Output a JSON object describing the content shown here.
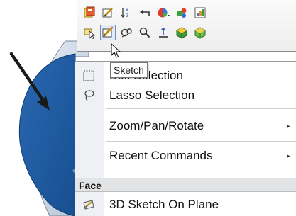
{
  "toolbar": {
    "row1": [
      {
        "icon": "component-properties-icon"
      },
      {
        "icon": "edit-sketch-icon"
      },
      {
        "icon": "sort-icon"
      },
      {
        "icon": "undo-arrow-icon"
      },
      {
        "icon": "appearance-icon"
      },
      {
        "icon": "add-relation-icon"
      },
      {
        "icon": "chart-icon"
      }
    ],
    "row2": [
      {
        "icon": "select-icon"
      },
      {
        "icon": "sketch-icon"
      },
      {
        "icon": "view-orientation-icon"
      },
      {
        "icon": "zoom-icon"
      },
      {
        "icon": "normal-to-icon"
      },
      {
        "icon": "box-shape-icon"
      },
      {
        "icon": "box-shape-alt-icon"
      }
    ]
  },
  "tooltip": {
    "text": "Sketch"
  },
  "menu": {
    "items": [
      {
        "label": "Box Selection",
        "icon": "box-selection-icon"
      },
      {
        "label": "Lasso Selection",
        "icon": "lasso-icon"
      },
      {
        "label": "Zoom/Pan/Rotate",
        "submenu": true
      },
      {
        "label": "Recent Commands",
        "submenu": true
      }
    ],
    "section": "Face",
    "face_items": [
      {
        "label": "3D Sketch On Plane",
        "icon": "3d-sketch-icon"
      }
    ]
  },
  "colors": {
    "face_blue": "#1f5aa0",
    "arrow": "#1a1a1a",
    "menu_bg": "#ffffff",
    "section_bg": "#e2e3e5"
  }
}
